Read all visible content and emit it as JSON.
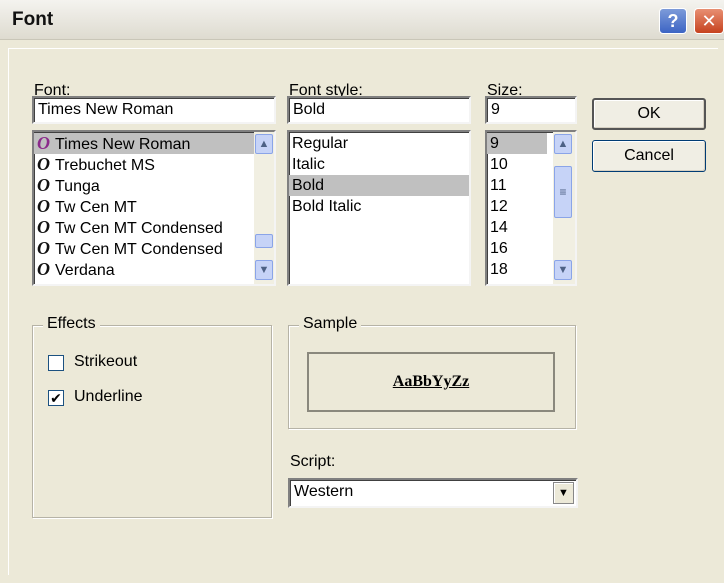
{
  "window": {
    "title": "Font",
    "help_label": "?",
    "close_label": "✕"
  },
  "font": {
    "label": "Font:",
    "value": "Times New Roman",
    "glyph": "O",
    "items": [
      {
        "label": "Times New Roman",
        "selected": true
      },
      {
        "label": "Trebuchet MS",
        "selected": false
      },
      {
        "label": "Tunga",
        "selected": false
      },
      {
        "label": "Tw Cen MT",
        "selected": false
      },
      {
        "label": "Tw Cen MT Condensed",
        "selected": false
      },
      {
        "label": "Tw Cen MT Condensed",
        "selected": false
      },
      {
        "label": "Verdana",
        "selected": false
      }
    ]
  },
  "style": {
    "label": "Font style:",
    "value": "Bold",
    "items": [
      {
        "label": "Regular",
        "selected": false
      },
      {
        "label": "Italic",
        "selected": false
      },
      {
        "label": "Bold",
        "selected": true
      },
      {
        "label": "Bold Italic",
        "selected": false
      }
    ]
  },
  "size": {
    "label": "Size:",
    "value": "9",
    "items": [
      {
        "label": "9",
        "selected": true
      },
      {
        "label": "10",
        "selected": false
      },
      {
        "label": "11",
        "selected": false
      },
      {
        "label": "12",
        "selected": false
      },
      {
        "label": "14",
        "selected": false
      },
      {
        "label": "16",
        "selected": false
      },
      {
        "label": "18",
        "selected": false
      }
    ]
  },
  "buttons": {
    "ok_label": "OK",
    "cancel_label": "Cancel"
  },
  "effects": {
    "title": "Effects",
    "strikeout": {
      "label": "Strikeout",
      "checked": false
    },
    "underline": {
      "label": "Underline",
      "checked": true
    },
    "check_mark": "✔"
  },
  "sample": {
    "title": "Sample",
    "text": "AaBbYyZz"
  },
  "script": {
    "label": "Script:",
    "value": "Western"
  },
  "icons": {
    "scroll_up": "▲",
    "scroll_down": "▼",
    "combo_down": "▼",
    "grip": "≡"
  },
  "colors": {
    "dialog_bg": "#ece9d8",
    "selection": "#c0c0c0",
    "selected_font_glyph": "#8b2a8b"
  }
}
